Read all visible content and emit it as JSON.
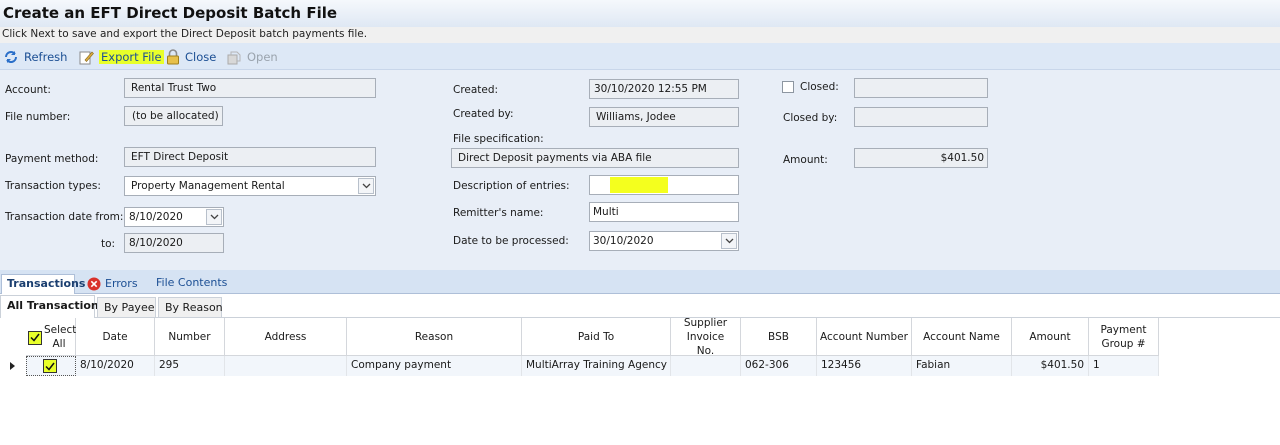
{
  "window": {
    "title": "Create an EFT Direct Deposit Batch File",
    "subtitle": "Click Next to save and export the Direct Deposit batch payments file."
  },
  "toolbar": {
    "refresh": "Refresh",
    "export": "Export File",
    "close": "Close",
    "open": "Open"
  },
  "form": {
    "account_label": "Account:",
    "account_value": "Rental Trust Two",
    "file_number_label": "File number:",
    "file_number_value": "(to be allocated)",
    "payment_method_label": "Payment method:",
    "payment_method_value": "EFT Direct Deposit",
    "transaction_types_label": "Transaction types:",
    "transaction_types_value": "Property Management Rental",
    "date_from_label": "Transaction date from:",
    "date_from_value": "8/10/2020",
    "date_to_label": "to:",
    "date_to_value": "8/10/2020",
    "created_label": "Created:",
    "created_value": "30/10/2020 12:55 PM",
    "created_by_label": "Created by:",
    "created_by_value": "Williams, Jodee",
    "file_spec_label": "File specification:",
    "file_spec_value": "Direct Deposit payments via ABA file",
    "description_label": "Description of entries:",
    "description_value": "",
    "remitter_label": "Remitter's name:",
    "remitter_value": "Multi",
    "date_processed_label": "Date to be processed:",
    "date_processed_value": "30/10/2020",
    "closed_label": "Closed:",
    "closed_value": "",
    "closed_by_label": "Closed by:",
    "closed_by_value": "",
    "amount_label": "Amount:",
    "amount_value": "$401.50"
  },
  "tabs": [
    "Transactions",
    "Errors",
    "File Contents"
  ],
  "subtabs": [
    "All Transactions",
    "By Payee",
    "By Reason"
  ],
  "grid": {
    "columns": [
      "Select All",
      "Date",
      "Number",
      "Address",
      "Reason",
      "Paid To",
      "Supplier Invoice No.",
      "BSB",
      "Account Number",
      "Account Name",
      "Amount",
      "Payment Group #"
    ],
    "rows": [
      {
        "selected": true,
        "date": "8/10/2020",
        "number": "295",
        "address": "",
        "reason": "Company payment",
        "paid_to": "MultiArray Training Agency",
        "supplier_invoice": "",
        "bsb": "062-306",
        "account_number": "123456",
        "account_name": "Fabian",
        "amount": "$401.50",
        "payment_group": "1"
      }
    ]
  },
  "colors": {
    "highlight": "#e8ff2a",
    "form_bg": "#e8eef7",
    "toolbar_bg": "#dde8f6",
    "link_blue": "#1c4f94"
  },
  "icons": [
    "refresh-icon",
    "export-file-icon",
    "lock-icon",
    "open-icon",
    "error-icon",
    "chevron-down-icon",
    "row-indicator-icon",
    "checkmark-icon"
  ]
}
